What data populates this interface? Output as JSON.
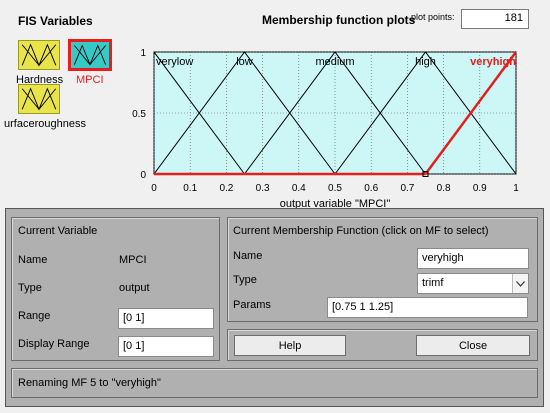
{
  "fis_panel": {
    "title": "FIS Variables",
    "variables": [
      {
        "label": "Hardness",
        "icon": "membership-icon",
        "selected": false
      },
      {
        "label": "MPCI",
        "icon": "membership-icon",
        "selected": true
      },
      {
        "label": "urfaceroughness",
        "icon": "membership-icon",
        "selected": false
      }
    ]
  },
  "plot": {
    "title": "Membership function plots",
    "plot_points_label": "plot points:",
    "plot_points_value": "181",
    "xlabel": "output variable \"MPCI\"",
    "x_ticks": [
      "0",
      "0.1",
      "0.2",
      "0.3",
      "0.4",
      "0.5",
      "0.6",
      "0.7",
      "0.8",
      "0.9",
      "1"
    ],
    "y_ticks": [
      "0",
      "0.5",
      "1"
    ],
    "bg_color": "#cdf6f6",
    "selected_color": "#e81d1d",
    "mfs": [
      {
        "name": "verylow",
        "params": [
          -0.25,
          0,
          0.25
        ],
        "selected": false
      },
      {
        "name": "low",
        "params": [
          0,
          0.25,
          0.5
        ],
        "selected": false
      },
      {
        "name": "medium",
        "params": [
          0.25,
          0.5,
          0.75
        ],
        "selected": false
      },
      {
        "name": "high",
        "params": [
          0.5,
          0.75,
          1
        ],
        "selected": false
      },
      {
        "name": "veryhigh",
        "params": [
          0.75,
          1,
          1.25
        ],
        "selected": true
      }
    ]
  },
  "current_variable": {
    "title": "Current Variable",
    "name_label": "Name",
    "name_value": "MPCI",
    "type_label": "Type",
    "type_value": "output",
    "range_label": "Range",
    "range_value": "[0 1]",
    "display_range_label": "Display Range",
    "display_range_value": "[0 1]"
  },
  "current_mf": {
    "title": "Current Membership Function (click on MF to select)",
    "name_label": "Name",
    "name_value": "veryhigh",
    "type_label": "Type",
    "type_value": "trimf",
    "params_label": "Params",
    "params_value": "[0.75 1 1.25]"
  },
  "buttons": {
    "help": "Help",
    "close": "Close"
  },
  "status": "Renaming MF 5 to \"veryhigh\""
}
